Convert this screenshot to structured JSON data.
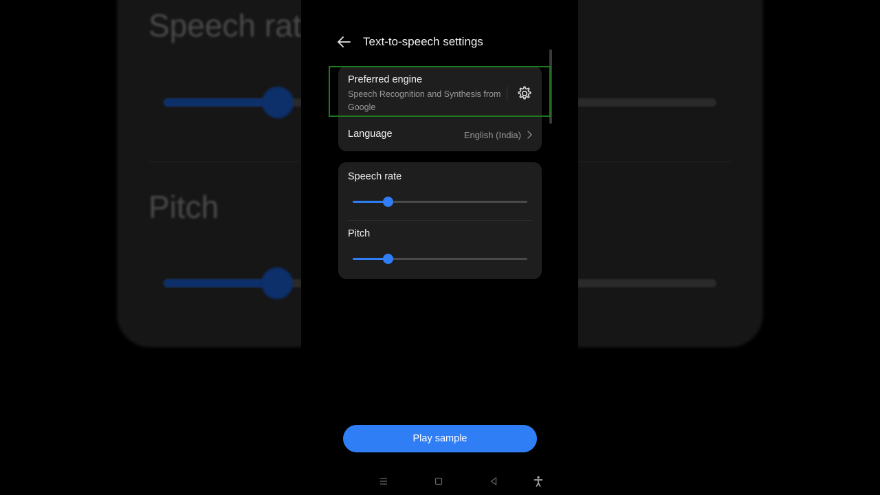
{
  "background": {
    "speech_rate_title": "Speech rat",
    "pitch_title": "Pitch"
  },
  "header": {
    "title": "Text-to-speech settings",
    "back_icon": "arrow-left-icon"
  },
  "engine": {
    "title": "Preferred engine",
    "subtitle": "Speech Recognition and Synthesis from Google",
    "settings_icon": "gear-icon"
  },
  "language": {
    "label": "Language",
    "value": "English (India)",
    "chevron_icon": "chevron-right-icon"
  },
  "sliders": {
    "speech_rate": {
      "label": "Speech rate",
      "value_fraction": 0.2
    },
    "pitch": {
      "label": "Pitch",
      "value_fraction": 0.2
    }
  },
  "play_button": {
    "label": "Play sample"
  },
  "navbar": {
    "icons": [
      "menu-icon",
      "home-square-icon",
      "back-triangle-icon",
      "accessibility-icon"
    ]
  },
  "colors": {
    "accent": "#2f7ef5",
    "card": "#1e1e1e",
    "highlight_border": "#1f7a1f"
  }
}
